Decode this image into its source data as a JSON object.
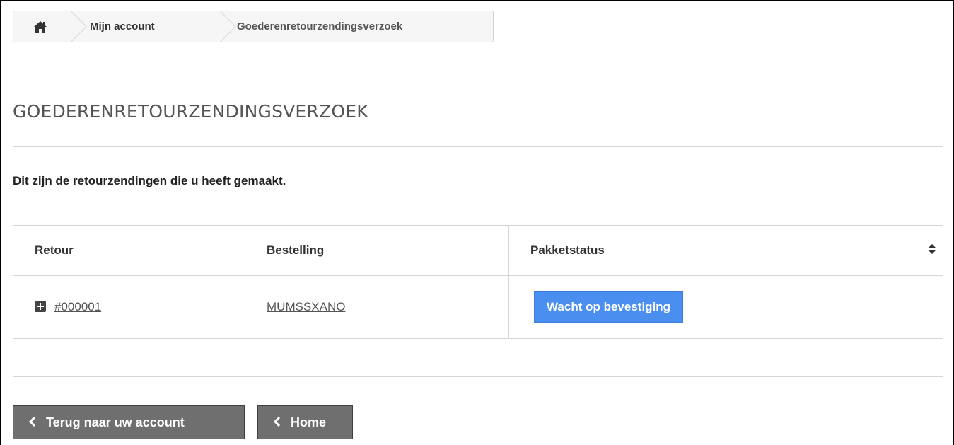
{
  "breadcrumb": {
    "home_icon": "home-icon",
    "items": [
      "Mijn account",
      "Goederenretourzendingsverzoek"
    ]
  },
  "page_title": "GOEDERENRETOURZENDINGSVERZOEK",
  "intro_text": "Dit zijn de retourzendingen die u heeft gemaakt.",
  "table": {
    "headers": [
      "Retour",
      "Bestelling",
      "Pakketstatus"
    ],
    "rows": [
      {
        "retour": "#000001",
        "bestelling": "MUMSSXANO",
        "status": "Wacht op bevestiging"
      }
    ]
  },
  "buttons": {
    "back_account": "Terug naar uw account",
    "home": "Home"
  },
  "colors": {
    "status_badge": "#4a8ff0",
    "button_bg": "#6f6f6f",
    "border": "#d6d4d4"
  }
}
